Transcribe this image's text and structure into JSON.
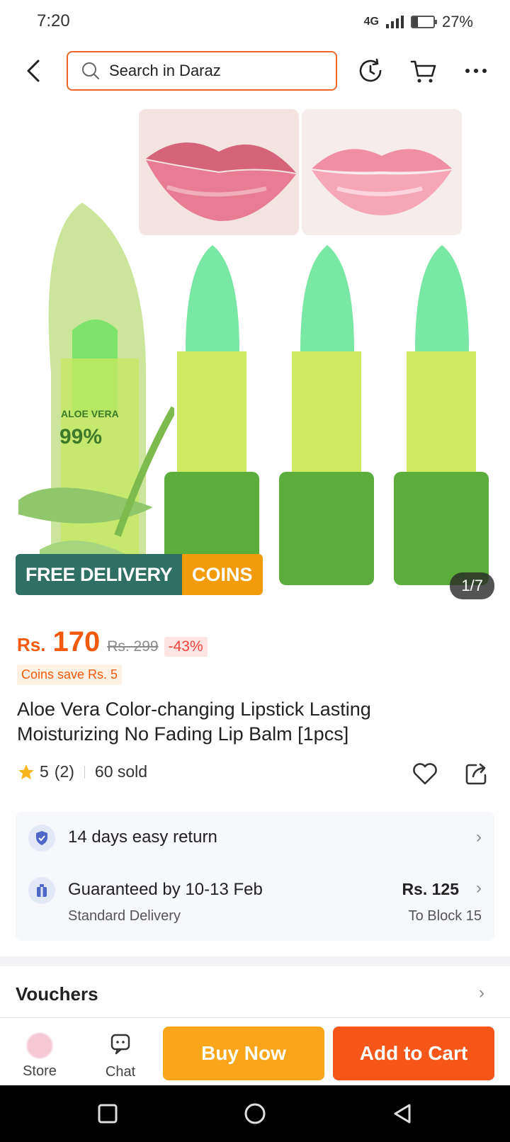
{
  "status_bar": {
    "time": "7:20",
    "network": "4G",
    "battery": "27%",
    "battery_level": 0.27
  },
  "header": {
    "search_placeholder": "Search in Daraz"
  },
  "gallery": {
    "badge_free_delivery": "FREE DELIVERY",
    "badge_coins": "COINS",
    "counter": "1/7",
    "product_print_line1": "ALOE VERA",
    "product_print_line2": "99%"
  },
  "price": {
    "currency": "Rs.",
    "current": "170",
    "original": "Rs. 299",
    "discount": "-43%",
    "coins_save": "Coins save Rs. 5"
  },
  "product": {
    "title": "Aloe Vera Color-changing Lipstick Lasting Moisturizing No Fading Lip Balm [1pcs]",
    "rating": "5",
    "reviews": "(2)",
    "sold": "60 sold"
  },
  "delivery": {
    "return_text": "14 days easy return",
    "guarantee_text": "Guaranteed by 10-13 Feb",
    "delivery_type": "Standard Delivery",
    "delivery_price": "Rs. 125",
    "destination": "To Block 15"
  },
  "vouchers": {
    "title": "Vouchers"
  },
  "bottom_bar": {
    "store_label": "Store",
    "chat_label": "Chat",
    "buy_now": "Buy Now",
    "add_to_cart": "Add to Cart"
  },
  "colors": {
    "accent_orange": "#f7561b",
    "buy_now_yellow": "#f9a61a",
    "free_delivery_green": "#2f6f64",
    "coins_amber": "#f29b0b"
  }
}
